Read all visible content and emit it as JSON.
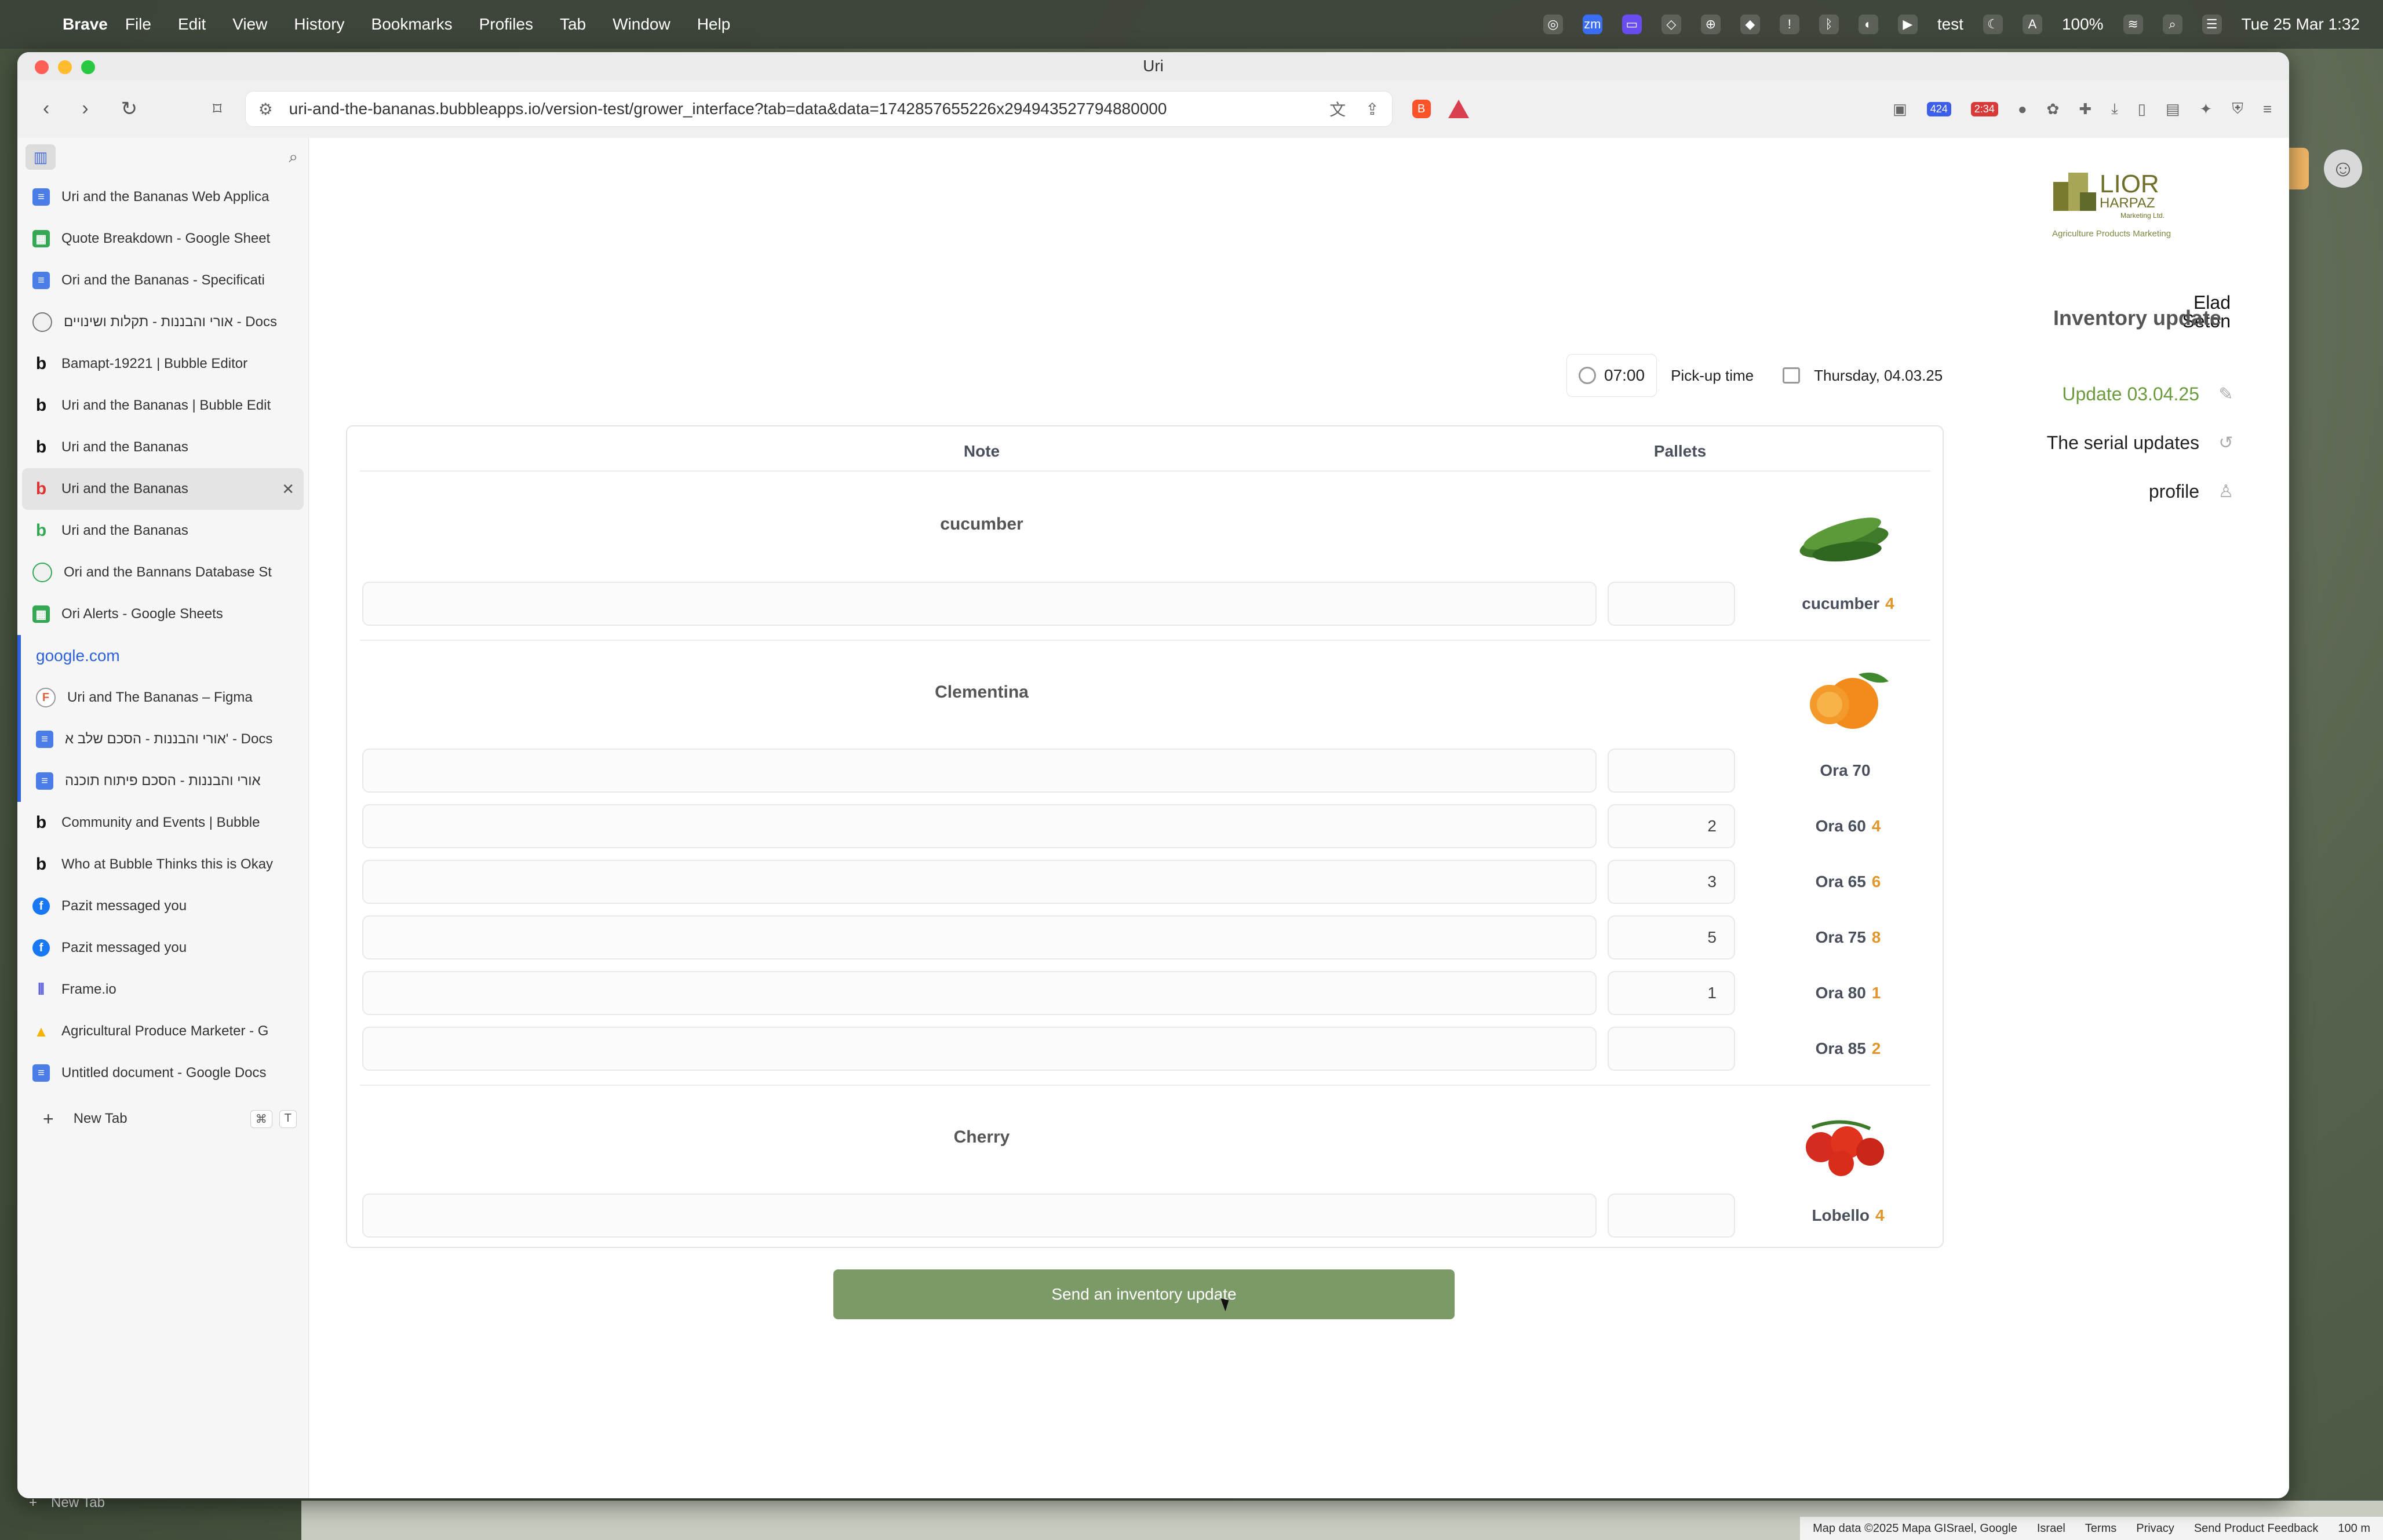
{
  "menubar": {
    "app": "Brave",
    "items": [
      "File",
      "Edit",
      "View",
      "History",
      "Bookmarks",
      "Profiles",
      "Tab",
      "Window",
      "Help"
    ],
    "status": {
      "user": "test",
      "battery": "100%",
      "datetime": "Tue 25 Mar  1:32"
    }
  },
  "window": {
    "title": "Uri"
  },
  "toolbar": {
    "url": "uri-and-the-bananas.bubbleapps.io/version-test/grower_interface?tab=data&data=1742857655226x294943527794880000",
    "badge1": "424",
    "badge2": "2:34"
  },
  "sidebar": {
    "tabs": [
      {
        "label": "Uri and the Bananas Web Applica",
        "icon": "doc"
      },
      {
        "label": "Quote Breakdown - Google Sheet",
        "icon": "sheet"
      },
      {
        "label": "Ori and the Bananas - Specificati",
        "icon": "doc"
      },
      {
        "label": "אורי והבננות - תקלות ושינויים - Docs",
        "icon": "globe"
      },
      {
        "label": "Bamapt-19221 | Bubble Editor",
        "icon": "bubble"
      },
      {
        "label": "Uri and the Bananas | Bubble Edit",
        "icon": "bubble"
      },
      {
        "label": "Uri and the Bananas",
        "icon": "bubble"
      },
      {
        "label": "Uri and the Bananas",
        "icon": "bubble"
      },
      {
        "label": "Uri and the Bananas",
        "icon": "bubble"
      },
      {
        "label": "Ori and the Bannans Database St",
        "icon": "globe"
      },
      {
        "label": "Ori Alerts - Google Sheets",
        "icon": "sheet"
      }
    ],
    "pinned_group": "google.com",
    "pinned_tabs": [
      {
        "label": "Uri and The Bananas – Figma",
        "icon": "figma"
      },
      {
        "label": "אורי והבננות - הסכם שלב א' - Docs",
        "icon": "doc"
      },
      {
        "label": "אורי והבננות - הסכם פיתוח תוכנה",
        "icon": "doc"
      }
    ],
    "more_tabs": [
      {
        "label": "Community and Events | Bubble",
        "icon": "bubble"
      },
      {
        "label": "Who at Bubble Thinks this is Okay",
        "icon": "bubble"
      },
      {
        "label": "Pazit messaged you",
        "icon": "fb"
      },
      {
        "label": "Pazit messaged you",
        "icon": "fb"
      },
      {
        "label": "Frame.io",
        "icon": "frame"
      },
      {
        "label": "Agricultural Produce Marketer - G",
        "icon": "drive"
      },
      {
        "label": "Untitled document - Google Docs",
        "icon": "doc"
      }
    ],
    "new_tab": "New Tab",
    "kbd1": "⌘",
    "kbd2": "T"
  },
  "page": {
    "logo": {
      "line1": "LIOR",
      "line2": "HARPAZ",
      "line3": "Marketing Ltd.",
      "tagline": "Agriculture Products Marketing"
    },
    "user": {
      "first": "Elad",
      "last": "Seton"
    },
    "menu": {
      "update": "Update 03.04.25",
      "serial": "The serial updates",
      "profile": "profile"
    },
    "title": "Inventory update",
    "time": "07:00",
    "pickup_label": "Pick-up time",
    "date": "Thursday, 04.03.25",
    "headers": {
      "note": "Note",
      "pallets": "Pallets"
    },
    "groups": [
      {
        "name": "cucumber",
        "rows": [
          {
            "label": "cucumber",
            "num": "4",
            "pallets": ""
          }
        ]
      },
      {
        "name": "Clementina",
        "rows": [
          {
            "label": "Ora 70",
            "num": "",
            "pallets": ""
          },
          {
            "label": "Ora 60",
            "num": "4",
            "pallets": "2"
          },
          {
            "label": "Ora 65",
            "num": "6",
            "pallets": "3"
          },
          {
            "label": "Ora 75",
            "num": "8",
            "pallets": "5"
          },
          {
            "label": "Ora 80",
            "num": "1",
            "pallets": "1"
          },
          {
            "label": "Ora 85",
            "num": "2",
            "pallets": ""
          }
        ]
      },
      {
        "name": "Cherry",
        "rows": [
          {
            "label": "Lobello",
            "num": "4",
            "pallets": ""
          }
        ]
      }
    ],
    "send_button": "Send an inventory update"
  },
  "map_footer": [
    "Map data ©2025 Mapa GISrael, Google",
    "Israel",
    "Terms",
    "Privacy",
    "Send Product Feedback",
    "100 m"
  ],
  "colors": {
    "accent_green": "#7b9a68",
    "number_orange": "#e0962a",
    "update_green": "#6b9b3e"
  }
}
